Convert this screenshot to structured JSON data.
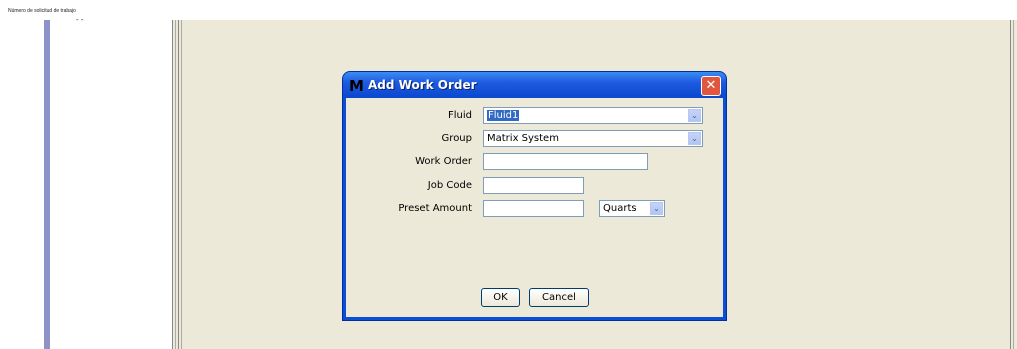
{
  "page": {
    "caption": "Número de solicitud de trabajo",
    "marker_text": "- -"
  },
  "dialog": {
    "logo": "M",
    "title": "Add Work Order",
    "close_glyph": "✕",
    "fields": {
      "fluid": {
        "label": "Fluid",
        "value": "Fluid1"
      },
      "group": {
        "label": "Group",
        "value": "Matrix System"
      },
      "work_order": {
        "label": "Work Order",
        "value": ""
      },
      "job_code": {
        "label": "Job Code",
        "value": ""
      },
      "preset_amount": {
        "label": "Preset Amount",
        "value": "",
        "unit": "Quarts"
      }
    },
    "dropdown_arrow": "⌄",
    "buttons": {
      "ok": "OK",
      "cancel": "Cancel"
    }
  },
  "colors": {
    "titlebar": "#0a4fd6",
    "dialog_bg": "#ece9d8",
    "selection": "#316ac5",
    "left_bar": "#8c93c9"
  }
}
